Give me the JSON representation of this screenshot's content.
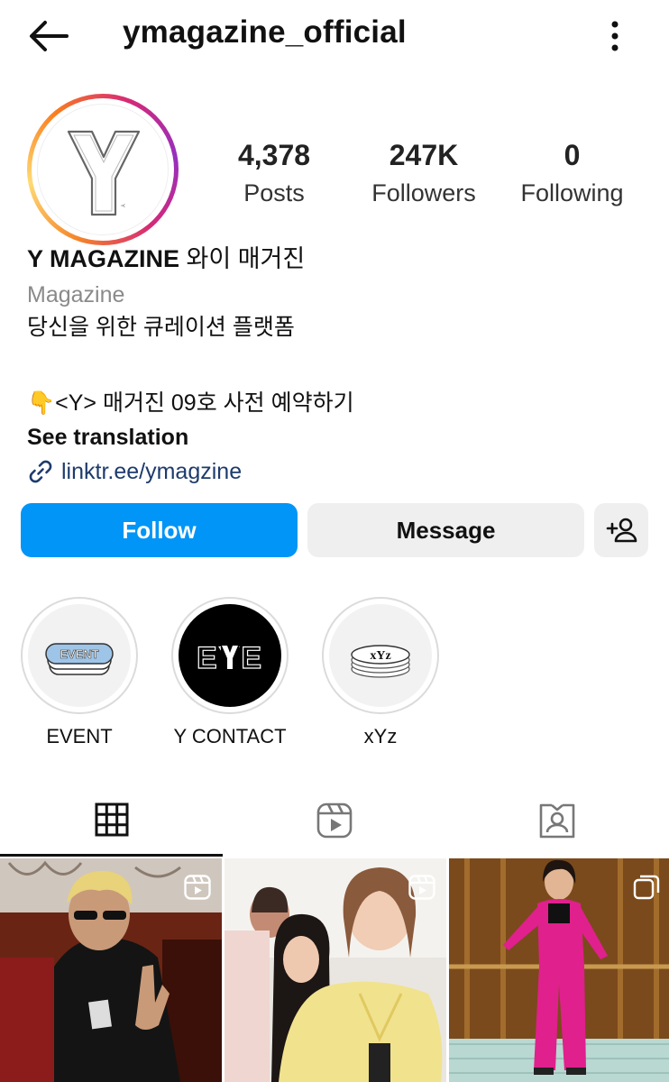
{
  "header": {
    "username": "ymagazine_official",
    "back_icon": "arrow-left-icon",
    "menu_icon": "more-vertical-icon"
  },
  "avatar": {
    "letter": "Y",
    "ring_colors": [
      "#f58529",
      "#d62976",
      "#962fbf"
    ]
  },
  "stats": {
    "posts": {
      "value": "4,378",
      "label": "Posts"
    },
    "followers": {
      "value": "247K",
      "label": "Followers"
    },
    "following": {
      "value": "0",
      "label": "Following"
    }
  },
  "bio": {
    "name": "Y MAGAZINE",
    "name_korean": "와이 매거진",
    "category": "Magazine",
    "tagline": "당신을 위한 큐레이션 플랫폼",
    "promo_emoji": "👇",
    "promo_text": "<Y> 매거진 09호 사전 예약하기",
    "see_translation": "See translation",
    "link": "linktr.ee/ymagzine"
  },
  "actions": {
    "follow_label": "Follow",
    "message_label": "Message",
    "add_user_icon": "add-person-icon"
  },
  "highlights": [
    {
      "label": "EVENT",
      "cover_text": "EVENT"
    },
    {
      "label": "Y CONTACT",
      "cover_text": "EYE"
    },
    {
      "label": "xYz",
      "cover_text": "xYz"
    }
  ],
  "tabs": [
    {
      "icon": "grid-icon",
      "active": true
    },
    {
      "icon": "reels-icon",
      "active": false
    },
    {
      "icon": "tagged-icon",
      "active": false
    }
  ],
  "colors": {
    "follow_blue": "#0095f6",
    "secondary_button": "#efefef",
    "link": "#1d3b6c",
    "muted_text": "#8a8a8a"
  },
  "posts": [
    {
      "type": "reel",
      "badge_icon": "reel-icon"
    },
    {
      "type": "reel",
      "badge_icon": "reel-icon"
    },
    {
      "type": "carousel",
      "badge_icon": "carousel-icon"
    }
  ]
}
